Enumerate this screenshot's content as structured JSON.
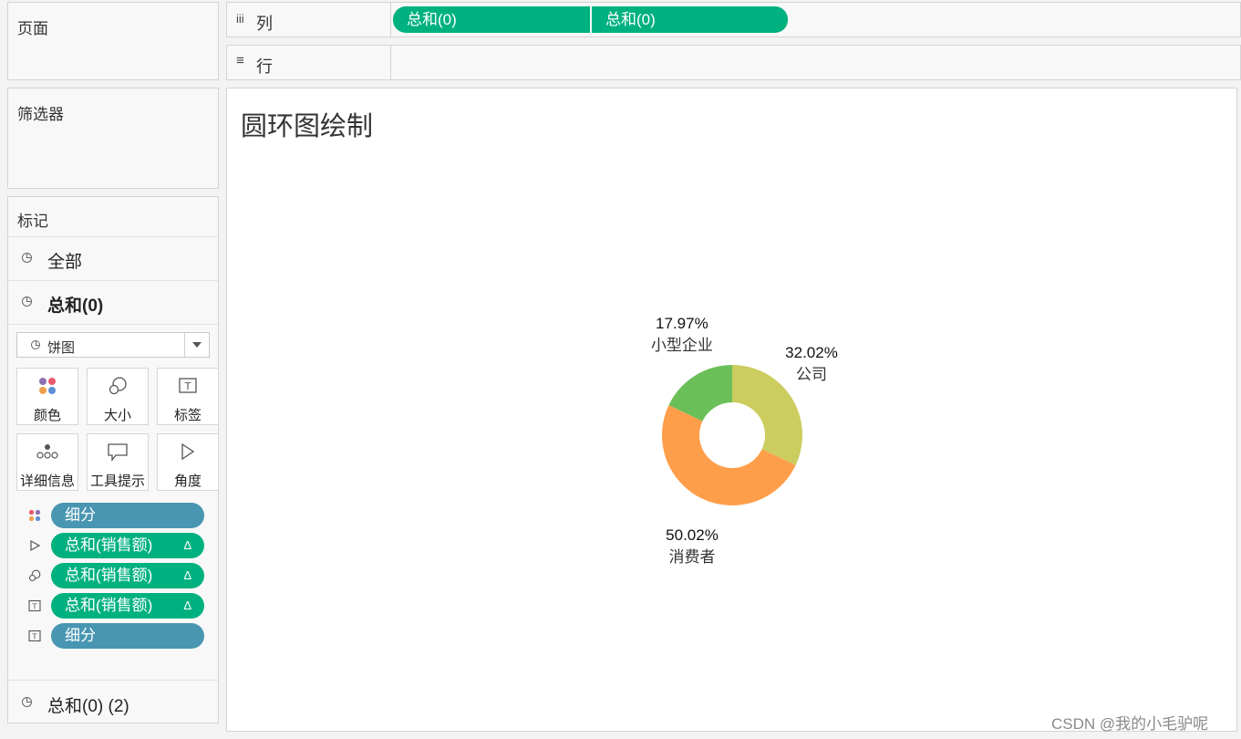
{
  "pages_panel": {
    "title": "页面"
  },
  "filters_panel": {
    "title": "筛选器"
  },
  "columns_shelf": {
    "icon": "iii",
    "label": "列",
    "pills": [
      "总和(0)",
      "总和(0)"
    ]
  },
  "rows_shelf": {
    "icon": "≡",
    "label": "行"
  },
  "marks_panel": {
    "title": "标记",
    "all_label": "全部",
    "layer1_label": "总和(0)",
    "mark_type": "饼图",
    "buttons": {
      "color": "颜色",
      "size": "大小",
      "label": "标签",
      "detail": "详细信息",
      "tooltip": "工具提示",
      "angle": "角度"
    },
    "pills": [
      {
        "icon": "color-icon",
        "label": "细分",
        "kind": "dimension"
      },
      {
        "icon": "angle-icon",
        "label": "总和(销售额)",
        "kind": "measure",
        "delta": "Δ"
      },
      {
        "icon": "size-icon",
        "label": "总和(销售额)",
        "kind": "measure",
        "delta": "Δ"
      },
      {
        "icon": "label-icon",
        "label": "总和(销售额)",
        "kind": "measure",
        "delta": "Δ"
      },
      {
        "icon": "label-icon",
        "label": "细分",
        "kind": "dimension"
      }
    ],
    "layer2_label": "总和(0) (2)"
  },
  "view": {
    "title": "圆环图绘制"
  },
  "watermark": "CSDN @我的小毛驴呢",
  "chart_data": {
    "type": "pie",
    "variant": "donut",
    "categories": [
      "公司",
      "消费者",
      "小型企业"
    ],
    "values": [
      32.02,
      50.02,
      17.97
    ],
    "value_labels": [
      "32.02%",
      "50.02%",
      "17.97%"
    ],
    "colors": [
      "#cccd5f",
      "#ff9e4a",
      "#6bbf59"
    ],
    "start": "12 o'clock, clockwise"
  }
}
